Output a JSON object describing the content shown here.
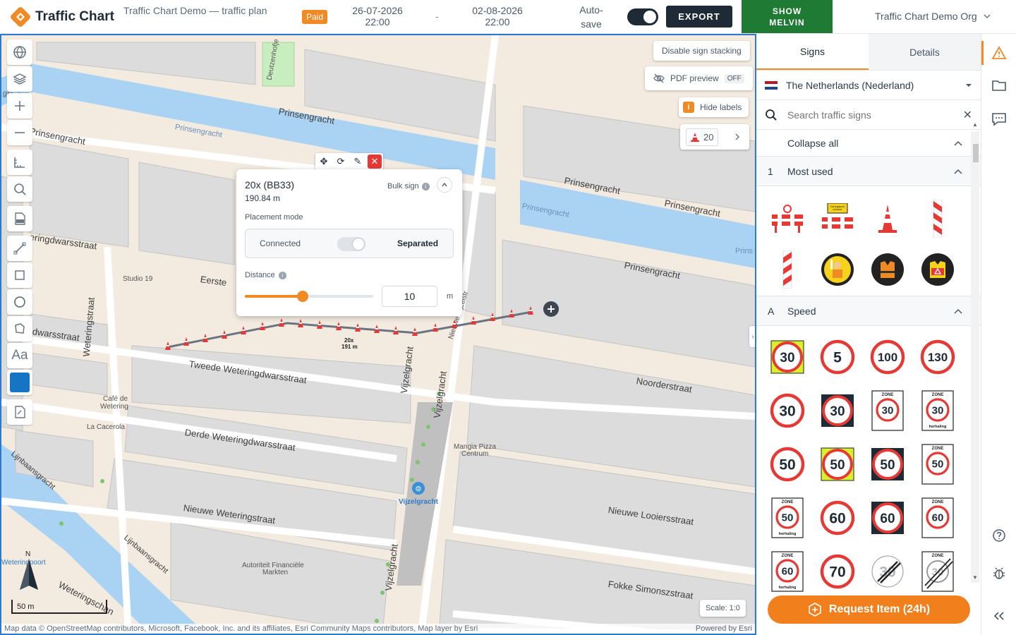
{
  "header": {
    "logo_text": "Traffic Chart",
    "plan_name": "Traffic Chart Demo — traffic plan",
    "status_badge": "Paid",
    "start_date": "26-07-2026",
    "start_time": "22:00",
    "date_separator": "-",
    "end_date": "02-08-2026",
    "end_time": "22:00",
    "autosave_label_1": "Auto-",
    "autosave_label_2": "save",
    "export_label": "EXPORT",
    "melvin_label_1": "SHOW",
    "melvin_label_2": "MELVIN",
    "org_name": "Traffic Chart Demo Org"
  },
  "map": {
    "buttons": {
      "sign_stacking": "Disable sign stacking",
      "pdf_preview": "PDF preview",
      "pdf_state": "OFF",
      "hide_labels": "Hide labels",
      "cone_count": "20"
    },
    "streets": {
      "prinsengracht_1": "Prinsengracht",
      "prinsengracht_2": "Prinsengracht",
      "prinsengracht_3": "Prinsengracht",
      "prinsengracht_4": "Prinsengracht",
      "prinsengracht_5": "Prinsengracht",
      "prinsengracht_water_1": "Prinsengracht",
      "prinsengracht_water_2": "Prinsengracht",
      "prinsengracht_water_3": "Prins",
      "prinsengracht_left": "Prinsengracht",
      "ringdwarsstraat": "eringdwarsstraat",
      "eerste": "Eerste",
      "tweede": "Tweede Weteringdwarsstraat",
      "derde": "Derde Weteringdwarsstraat",
      "dwarsstraat": "dwarsstraat",
      "weteringstraat": "Weteringstraat",
      "vijzelgracht_1": "Vijzelgracht",
      "vijzelgracht_2": "Vijzelgracht",
      "vijzelgracht_3": "Vijzelgracht",
      "noorderstraat": "Noorderstraat",
      "nieuwe_looiersstraat": "Nieuwe Looiersstraat",
      "nieuwe_weteringstraat": "Nieuwe Weteringstraat",
      "fokke": "Fokke Simonszstraat",
      "lijnbaansgracht_1": "Lijnbaansgracht",
      "lijnbaansgracht_2": "Lijnbaansgracht",
      "weteringschans": "Weteringschan",
      "deutzenhofje": "Deutzenhofje",
      "nieuwe_vijzel": "Nieuwe Vijzelstr",
      "gracht_top": "gracht",
      "prinsen_top_right": "Prinsen"
    },
    "pois": {
      "studio19": "Studio 19",
      "cafe_1": "Café de",
      "cafe_2": "Wetering",
      "la_cacerola": "La Cacerola",
      "mangia_1": "Mangia Pizza",
      "mangia_2": "Centrum",
      "tram_stop": "Vijzelgracht",
      "autoriteit_1": "Autoriteit Financiële",
      "autoriteit_2": "Markten",
      "weteringpoort": "Weteringpoort"
    },
    "line_label_1": "20x",
    "line_label_2": "191 m",
    "north": "N",
    "scale_bar": "50 m",
    "scale": "Scale: 1:0",
    "attribution": "Map data © OpenStreetMap contributors, Microsoft, Facebook, Inc. and its affiliates, Esri Community Maps contributors, Map layer by Esri",
    "powered_by": "Powered by Esri"
  },
  "popup": {
    "title": "20x (BB33)",
    "length": "190.84 m",
    "bulk_label": "Bulk sign",
    "placement_label": "Placement mode",
    "connected": "Connected",
    "separated": "Separated",
    "distance_label": "Distance",
    "distance_value": "10",
    "distance_unit": "m",
    "slider_fraction": 0.45
  },
  "sidebar": {
    "tab_signs": "Signs",
    "tab_details": "Details",
    "country": "The Netherlands (Nederland)",
    "search_placeholder": "Search traffic signs",
    "collapse_all": "Collapse all",
    "section_1_index": "1",
    "section_1_label": "Most used",
    "section_a_index": "A",
    "section_a_label": "Speed",
    "request_label": "Request Item (24h)",
    "speed_signs": [
      {
        "value": "30",
        "style": "yellow"
      },
      {
        "value": "5",
        "style": "plain"
      },
      {
        "value": "100",
        "style": "plain"
      },
      {
        "value": "130",
        "style": "plain"
      },
      {
        "value": "30",
        "style": "plain"
      },
      {
        "value": "30",
        "style": "black"
      },
      {
        "value": "30",
        "style": "zone"
      },
      {
        "value": "30",
        "style": "zone-herhaling"
      },
      {
        "value": "50",
        "style": "plain"
      },
      {
        "value": "50",
        "style": "yellow"
      },
      {
        "value": "50",
        "style": "black"
      },
      {
        "value": "50",
        "style": "zone"
      },
      {
        "value": "50",
        "style": "zone-herhaling"
      },
      {
        "value": "60",
        "style": "plain"
      },
      {
        "value": "60",
        "style": "black"
      },
      {
        "value": "60",
        "style": "zone"
      },
      {
        "value": "60",
        "style": "zone-herhaling"
      },
      {
        "value": "70",
        "style": "plain"
      },
      {
        "value": "30",
        "style": "end"
      },
      {
        "value": "30",
        "style": "zone-end"
      }
    ],
    "zone_text": "ZONE",
    "herhaling_text": "herhaling",
    "most_used_sign_text": "Doorgaand verkeer gestremd"
  },
  "colors": {
    "accent": "#f08a24",
    "export_bg": "#1f2a37",
    "melvin_bg": "#1f7a34",
    "map_border": "#2f7ac8",
    "water": "#aad3f3",
    "cone": "#e53935"
  }
}
